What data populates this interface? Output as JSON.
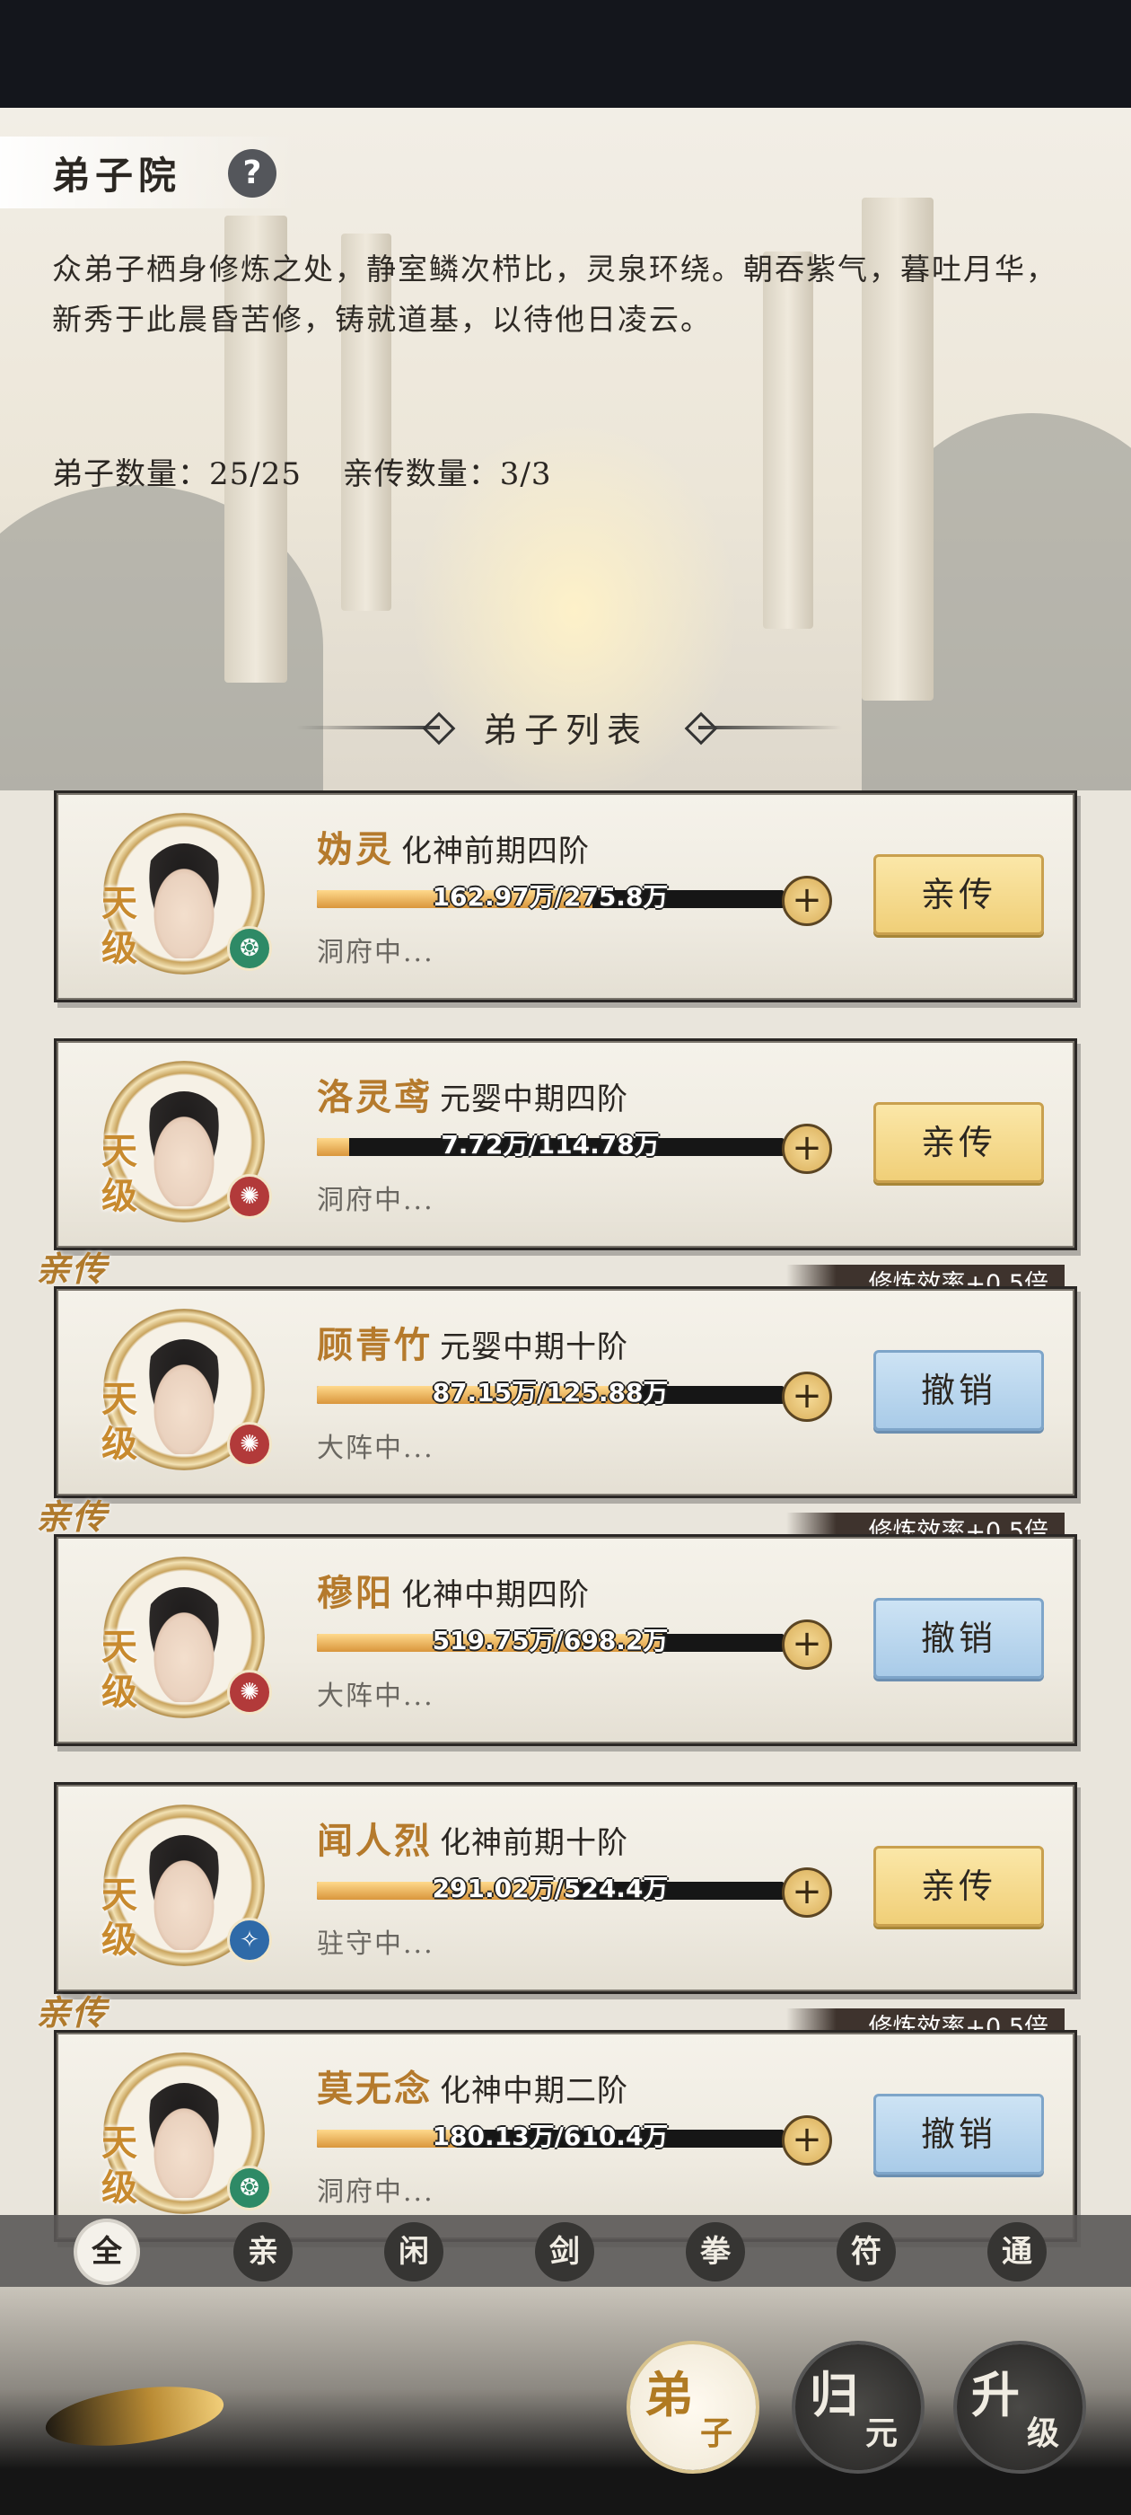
{
  "header": {
    "title": "弟子院",
    "help_icon": "?",
    "description": "众弟子栖身修炼之处，静室鳞次栉比，灵泉环绕。朝吞紫气，暮吐月华，新秀于此晨昏苦修，铸就道基，以待他日凌云。",
    "disciple_count": "弟子数量：25/25",
    "direct_count": "亲传数量：3/3",
    "list_title": "弟子列表"
  },
  "disciples": [
    {
      "grade": "天级",
      "name": "妫灵",
      "rank": "化神前期四阶",
      "progress": "162.97万/275.8万",
      "progress_fraction": 0.59,
      "location": "洞府中...",
      "element": "green",
      "element_icon": "wind-icon",
      "action": "亲传",
      "is_direct": false
    },
    {
      "grade": "天级",
      "name": "洛灵鸢",
      "rank": "元婴中期四阶",
      "progress": "7.72万/114.78万",
      "progress_fraction": 0.07,
      "location": "洞府中...",
      "element": "red",
      "element_icon": "fire-icon",
      "action": "亲传",
      "is_direct": false
    },
    {
      "grade": "天级",
      "name": "顾青竹",
      "rank": "元婴中期十阶",
      "progress": "87.15万/125.88万",
      "progress_fraction": 0.69,
      "location": "大阵中...",
      "element": "red",
      "element_icon": "fire-icon",
      "action": "撤销",
      "is_direct": true,
      "tag": "亲传",
      "bonus": "修炼效率+0.5倍"
    },
    {
      "grade": "天级",
      "name": "穆阳",
      "rank": "化神中期四阶",
      "progress": "519.75万/698.2万",
      "progress_fraction": 0.74,
      "location": "大阵中...",
      "element": "red",
      "element_icon": "fire-icon",
      "action": "撤销",
      "is_direct": true,
      "tag": "亲传",
      "bonus": "修炼效率+0.5倍"
    },
    {
      "grade": "天级",
      "name": "闻人烈",
      "rank": "化神前期十阶",
      "progress": "291.02万/524.4万",
      "progress_fraction": 0.55,
      "location": "驻守中...",
      "element": "blue",
      "element_icon": "water-icon",
      "action": "亲传",
      "is_direct": false
    },
    {
      "grade": "天级",
      "name": "莫无念",
      "rank": "化神中期二阶",
      "progress": "180.13万/610.4万",
      "progress_fraction": 0.3,
      "location": "洞府中...",
      "element": "green",
      "element_icon": "wind-icon",
      "action": "撤销",
      "is_direct": true,
      "tag": "亲传",
      "bonus": "修炼效率+0.5倍"
    }
  ],
  "filters": [
    "全",
    "亲",
    "闲",
    "剑",
    "拳",
    "符",
    "通"
  ],
  "active_filter": 0,
  "nav": [
    {
      "a": "弟",
      "b": "子",
      "active": true
    },
    {
      "a": "归",
      "b": "元",
      "active": false
    },
    {
      "a": "升",
      "b": "级",
      "active": false
    }
  ]
}
